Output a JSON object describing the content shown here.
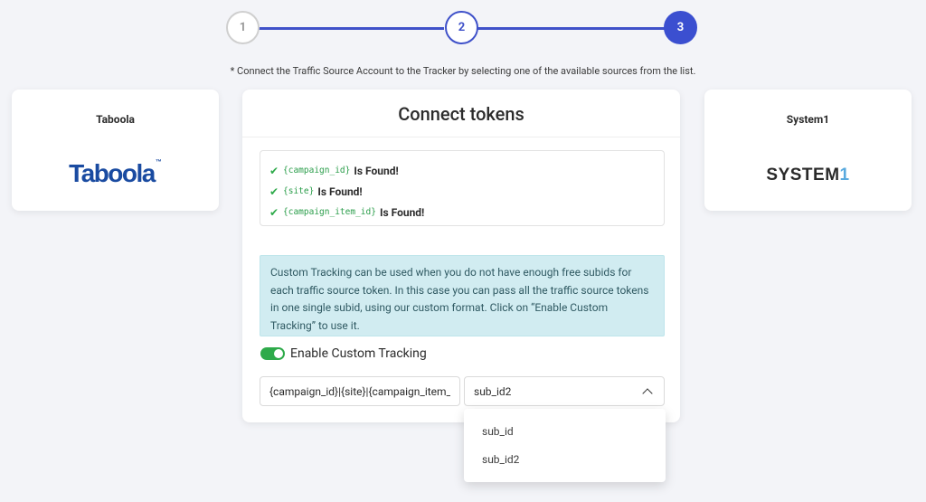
{
  "stepper": {
    "steps": [
      {
        "label": "1",
        "state": "inactive"
      },
      {
        "label": "2",
        "state": "completed"
      },
      {
        "label": "3",
        "state": "active"
      }
    ],
    "accent_color": "#3b4fd0"
  },
  "hint": "* Connect the Traffic Source Account to the Tracker by selecting one of the available sources from the list.",
  "sources": {
    "left": {
      "title": "Taboola",
      "logo_text": "Taboola",
      "logo_tm": "™"
    },
    "right": {
      "title": "System1",
      "logo_text": "SYSTEM",
      "logo_suffix": "1"
    }
  },
  "main": {
    "title": "Connect tokens",
    "tokens": [
      {
        "code": "{campaign_id}",
        "status": "Is Found!"
      },
      {
        "code": "{site}",
        "status": "Is Found!"
      },
      {
        "code": "{campaign_item_id}",
        "status": "Is Found!"
      }
    ],
    "info": "Custom Tracking can be used when you do not have enough free subids for each traffic source token. In this case you can pass all the traffic source tokens in one single subid, using our custom format. Click on “Enable Custom Tracking” to use it.",
    "toggle": {
      "label": "Enable Custom Tracking",
      "checked": true
    },
    "format_value": "{campaign_id}|{site}|{campaign_item_id}",
    "select": {
      "selected": "sub_id2",
      "options": [
        "sub_id",
        "sub_id2"
      ]
    }
  },
  "icons": {
    "check": "check-icon",
    "chevron": "chevron-up-icon"
  },
  "colors": {
    "success": "#2eaa4a",
    "info_bg": "#d1ecf1"
  }
}
